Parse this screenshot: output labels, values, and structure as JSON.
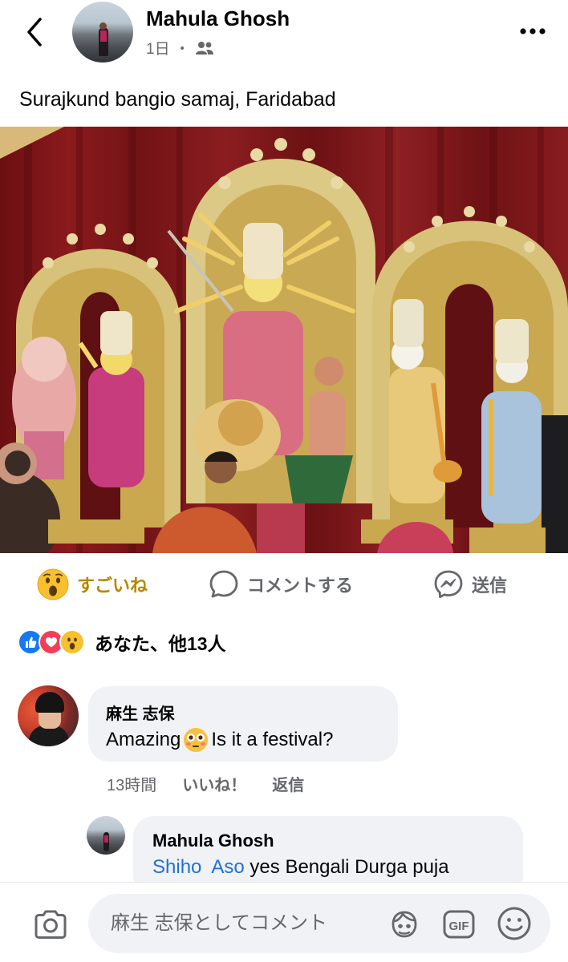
{
  "post": {
    "author": "Mahula Ghosh",
    "time": "1日",
    "separator": "・",
    "caption": "Surajkund bangio samaj, Faridabad",
    "photo_icon": "durga-puja-idols-photo"
  },
  "actions": {
    "like_label": "すごいね",
    "comment_label": "コメントする",
    "send_label": "送信"
  },
  "reactions": {
    "text": "あなた、他13人",
    "icons": [
      "like-icon",
      "love-icon",
      "wow-icon"
    ]
  },
  "comment": {
    "name": "麻生 志保",
    "text": "Amazing",
    "text_after_emoji": " Is it a festival?",
    "time": "13時間",
    "like_label": "いいね！",
    "reply_label": "返信"
  },
  "reply": {
    "name": "Mahula Ghosh",
    "mention_first": "Shiho",
    "mention_last": "Aso",
    "text": " yes Bengali Durga puja"
  },
  "composer": {
    "placeholder": "麻生 志保としてコメント"
  },
  "colors": {
    "like_gold": "#b88700",
    "secondary_text": "#65676b",
    "bubble_bg": "#f0f2f5",
    "mention_blue": "#216fdb"
  }
}
